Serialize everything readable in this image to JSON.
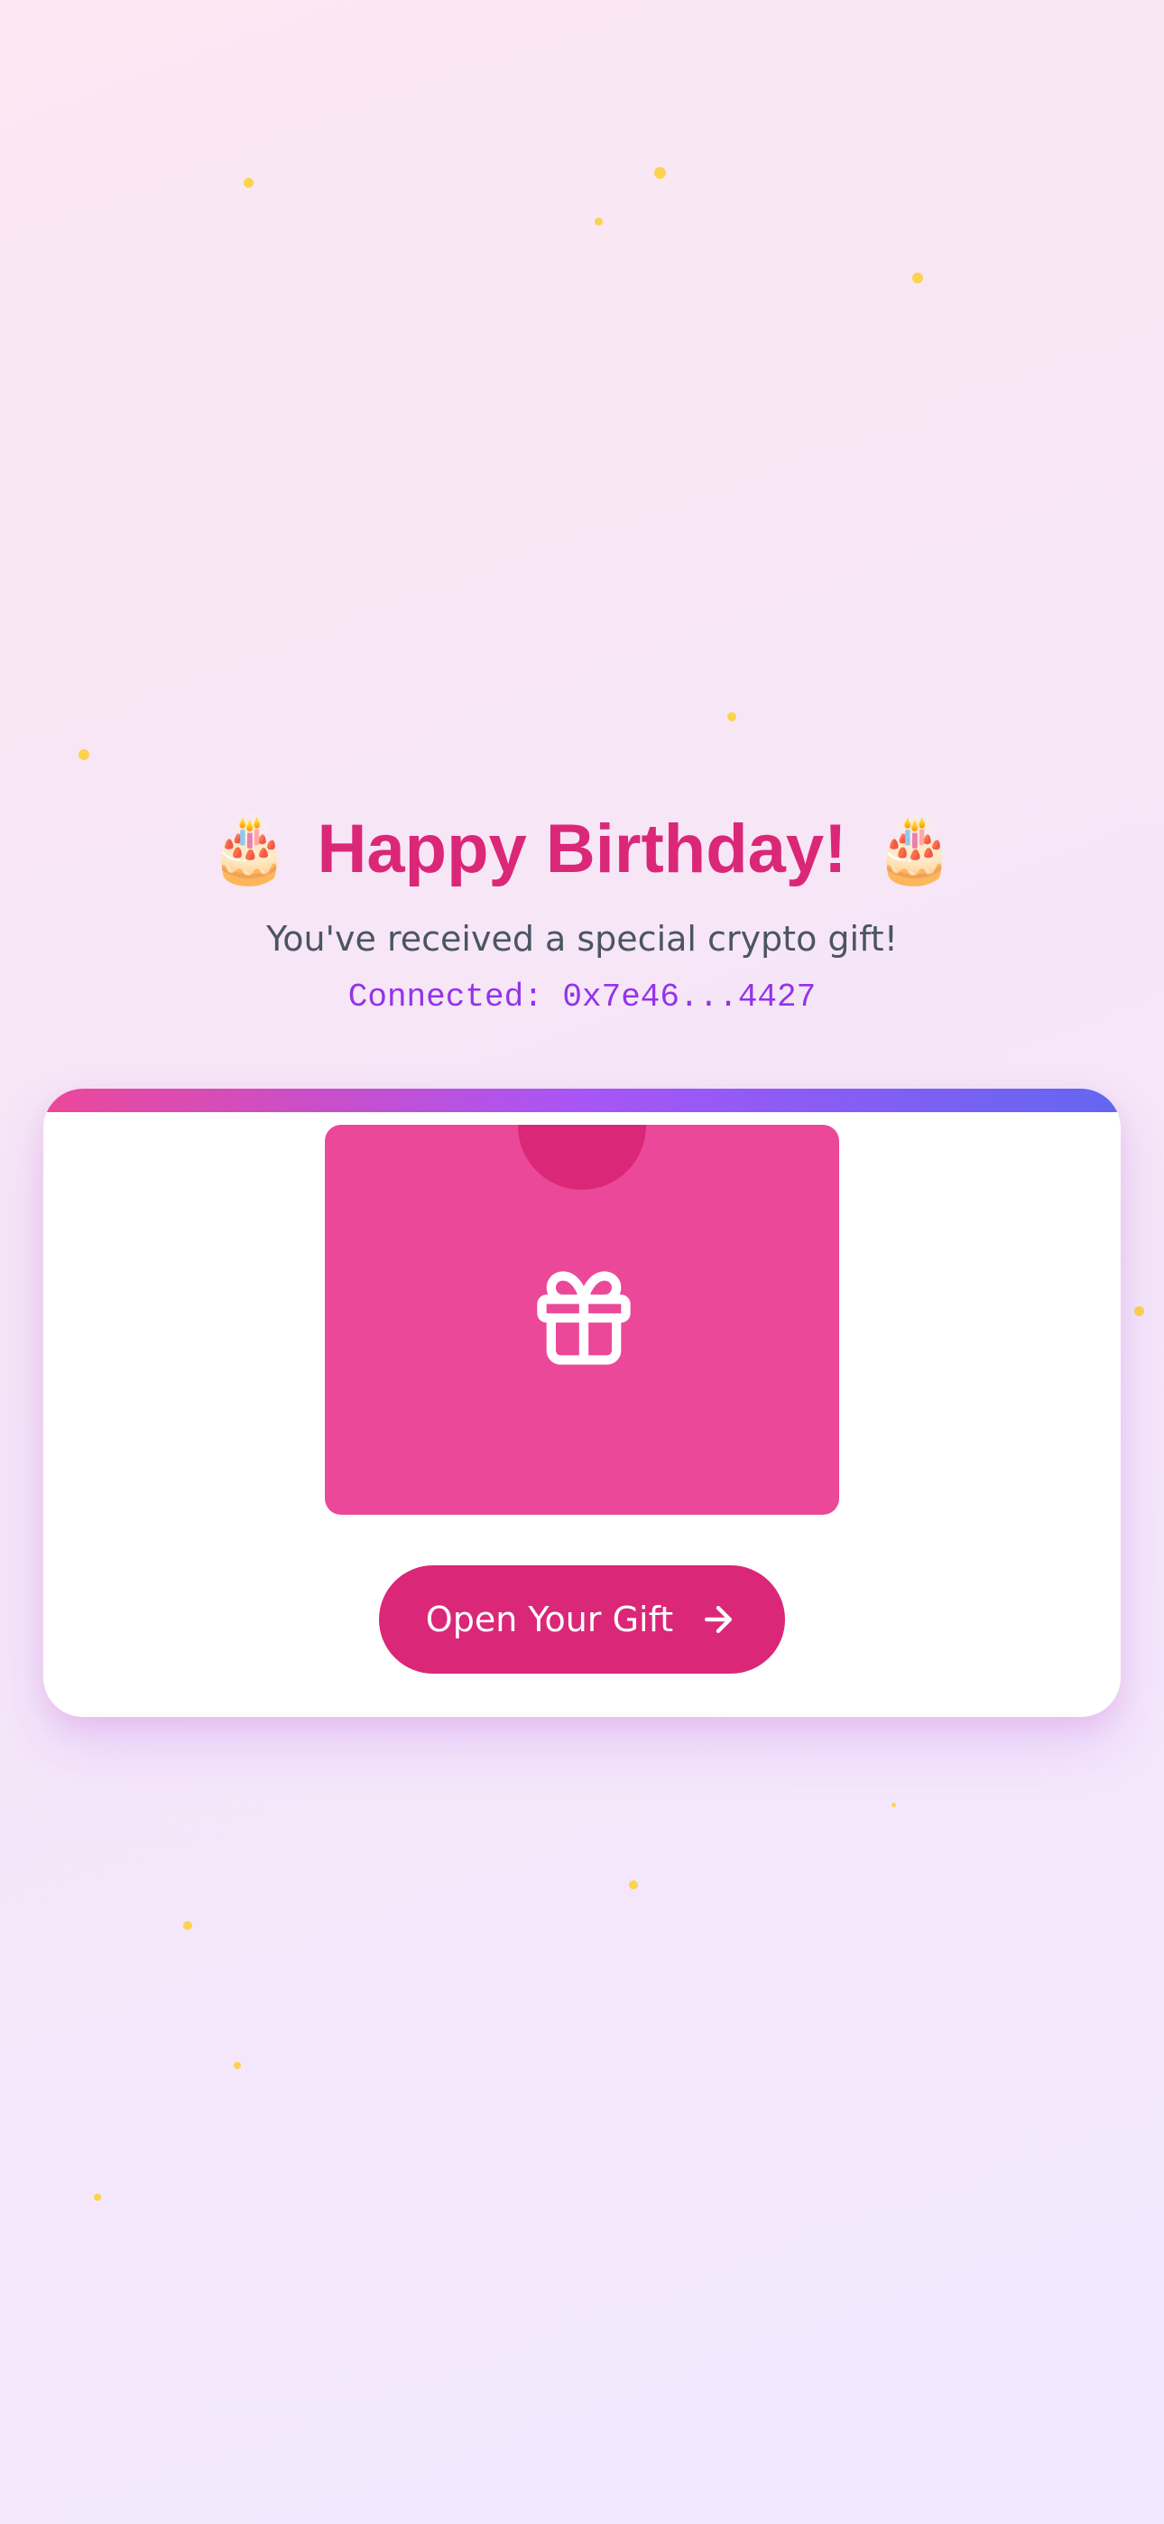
{
  "greeting": {
    "title": "Happy Birthday!",
    "left_emoji": "🎂",
    "right_emoji": "🎂",
    "subtitle": "You've received a special crypto gift!",
    "wallet_status": "Connected: 0x7e46...4427"
  },
  "gift_card": {
    "icon": "gift-icon",
    "button_label": "Open Your Gift",
    "button_icon": "arrow-right-icon"
  },
  "colors": {
    "accent": "#db2777",
    "gift_box": "#ec4899",
    "wallet_text": "#9333ea",
    "confetti": "#fcd34d",
    "bar_gradient": [
      "#ec4899",
      "#a855f7",
      "#6366f1"
    ]
  }
}
